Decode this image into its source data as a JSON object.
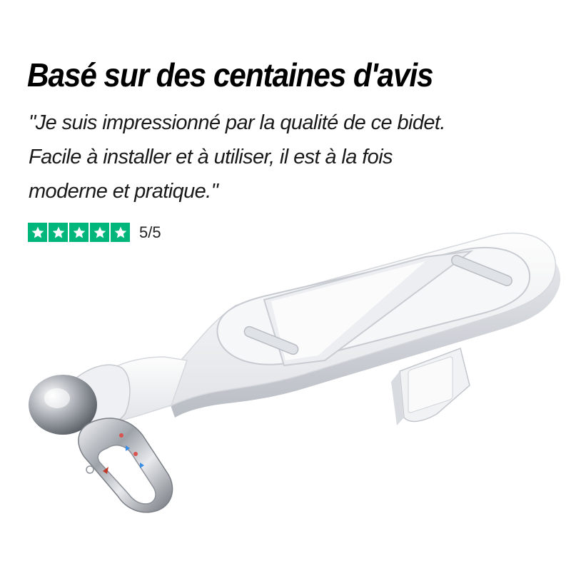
{
  "headline": "Basé sur des centaines d'avis",
  "review": {
    "lines": [
      "\"Je suis impressionné par la qualité de ce bidet.",
      "Facile à installer et à utiliser, il est à la fois",
      "moderne et pratique.\""
    ]
  },
  "rating": {
    "score_text": "5/5",
    "stars": 5,
    "star_color": "#00b67a",
    "star_icon": "star-icon"
  },
  "product": {
    "image_icon": "bidet-attachment-image"
  }
}
